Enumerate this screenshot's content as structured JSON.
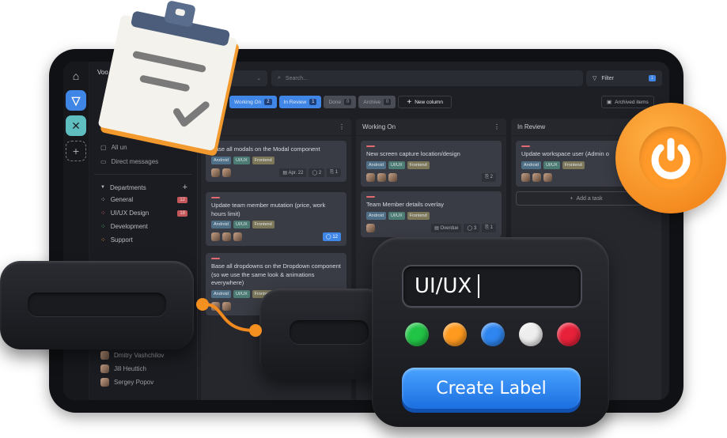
{
  "sidebar": {
    "workspace": "Voo",
    "items": [
      {
        "label": "All un",
        "icon": "chat-icon"
      },
      {
        "label": "Direct messages",
        "icon": "inbox-icon"
      }
    ],
    "departments_label": "Departments",
    "departments": [
      {
        "label": "General",
        "badge": "12",
        "color": "#c9ccd3"
      },
      {
        "label": "UI/UX Design",
        "badge": "18",
        "color": "#e06a6f"
      },
      {
        "label": "Development",
        "badge": "",
        "color": "#4fc07a"
      },
      {
        "label": "Support",
        "badge": "",
        "color": "#f0953a"
      }
    ],
    "users": [
      "Dmitry Vashchilov",
      "Jill Heuttich",
      "Sergey Popov"
    ]
  },
  "toolbar": {
    "search_placeholder": "Search...",
    "filter_label": "Filter",
    "filter_count": "1",
    "tabs": [
      {
        "label": "Working On",
        "count": "2",
        "active": true
      },
      {
        "label": "In Review",
        "count": "1",
        "active": true
      },
      {
        "label": "Done",
        "count": "0",
        "active": false
      },
      {
        "label": "Archive",
        "count": "0",
        "active": false
      }
    ],
    "new_column": "New column",
    "archived_items": "Archived items"
  },
  "columns": [
    {
      "title": "",
      "cards": [
        {
          "title": "Base all modals on the Modal component",
          "tags": [
            "Android",
            "UI/UX",
            "Frontend"
          ],
          "date": "Apr. 22",
          "comments": "2",
          "attachments": "1"
        },
        {
          "title": "Update team member mutation (price, work hours limit)",
          "tags": [
            "Android",
            "UI/UX",
            "Frontend"
          ],
          "comments": "12"
        },
        {
          "title": "Base all dropdowns on the Dropdown component (so we use the same look & animations everywhere)",
          "tags": [
            "Android",
            "UI/UX",
            "Frontend"
          ]
        }
      ]
    },
    {
      "title": "Working On",
      "cards": [
        {
          "title": "New screen capture location/design",
          "tags": [
            "Android",
            "UI/UX",
            "Frontend"
          ],
          "attachments": "2"
        },
        {
          "title": "Team Member details overlay",
          "tags": [
            "Android",
            "UI/UX",
            "Frontend"
          ],
          "date": "Overdue",
          "comments": "3",
          "attachments": "1"
        }
      ]
    },
    {
      "title": "In Review",
      "cards": [
        {
          "title": "Update workspace user (Admin o",
          "tags": [
            "Android",
            "UI/UX",
            "Frontend"
          ]
        }
      ],
      "add_task": "Add a task"
    }
  ],
  "label_widget": {
    "input_value": "UI/UX",
    "colors": [
      "#22c447",
      "#ff9a1f",
      "#2f86f0",
      "#eeeeee",
      "#e8213a"
    ],
    "button": "Create Label"
  },
  "accent": "#3f86e6"
}
